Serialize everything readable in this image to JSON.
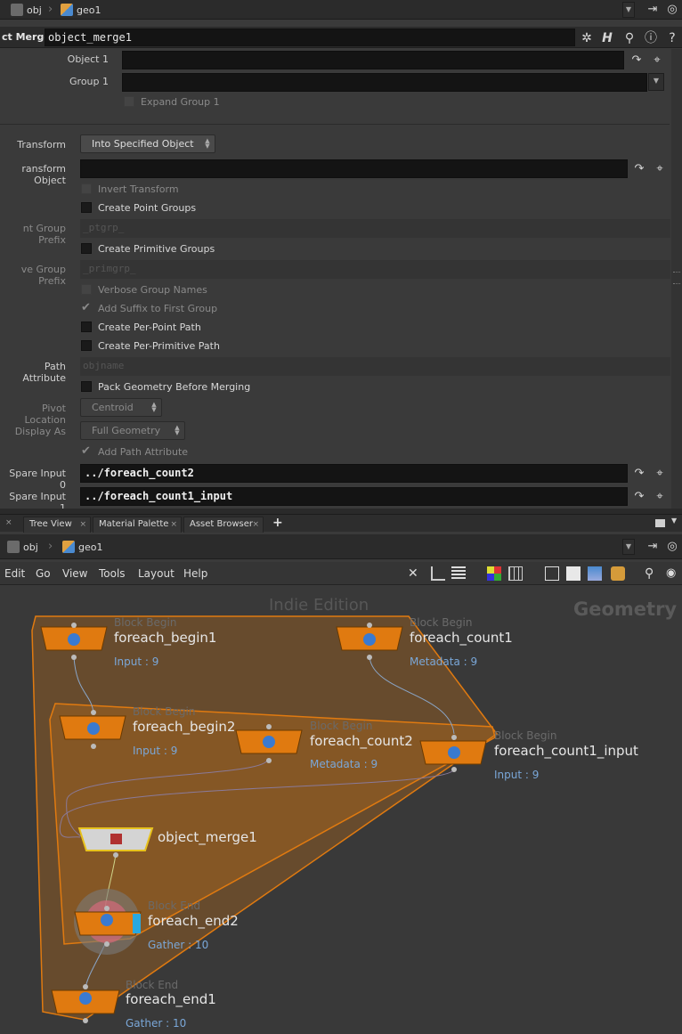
{
  "top_path": {
    "root": "obj",
    "node": "geo1"
  },
  "node_header": {
    "type_label": "ct Merge",
    "name": "object_merge1"
  },
  "params": {
    "object1": {
      "label": "Object 1",
      "value": ""
    },
    "group1": {
      "label": "Group 1",
      "value": ""
    },
    "expand_group1": {
      "label": "Expand Group 1",
      "checked": false
    },
    "transform": {
      "label": "Transform",
      "value": "Into Specified Object"
    },
    "transform_object": {
      "label": "ransform Object",
      "value": ""
    },
    "invert_transform": {
      "label": "Invert Transform",
      "checked": false
    },
    "create_point_groups": {
      "label": "Create Point Groups",
      "checked": false
    },
    "point_group_prefix": {
      "label": "nt Group Prefix",
      "value": "_ptgrp_"
    },
    "create_primitive_groups": {
      "label": "Create Primitive Groups",
      "checked": false
    },
    "primitive_group_prefix": {
      "label": "ve Group Prefix",
      "value": "_primgrp_"
    },
    "verbose_group_names": {
      "label": "Verbose Group Names",
      "checked": false
    },
    "add_suffix": {
      "label": "Add Suffix to First Group",
      "checked": true
    },
    "per_point_path": {
      "label": "Create Per-Point Path",
      "checked": false
    },
    "per_prim_path": {
      "label": "Create Per-Primitive Path",
      "checked": false
    },
    "path_attribute": {
      "label": "Path Attribute",
      "value": "objname"
    },
    "pack_geometry": {
      "label": "Pack Geometry Before Merging",
      "checked": false
    },
    "pivot_location": {
      "label": "Pivot Location",
      "value": "Centroid"
    },
    "display_as": {
      "label": "Display As",
      "value": "Full Geometry"
    },
    "add_path_attribute": {
      "label": "Add Path Attribute",
      "checked": true
    },
    "spare_input0": {
      "label": "Spare Input 0",
      "value": "../foreach_count2"
    },
    "spare_input1": {
      "label": "Spare Input 1",
      "value": "../foreach_count1_input"
    }
  },
  "tabs": [
    {
      "label": "Tree View"
    },
    {
      "label": "Material Palette"
    },
    {
      "label": "Asset Browser"
    }
  ],
  "tab_add": "+",
  "net_path": {
    "root": "obj",
    "node": "geo1"
  },
  "menu": [
    "Edit",
    "Go",
    "View",
    "Tools",
    "Layout",
    "Help"
  ],
  "network": {
    "watermark": "Indie Edition",
    "context": "Geometry",
    "nodes": [
      {
        "type": "Block Begin",
        "name": "foreach_begin1",
        "info": "Input : 9"
      },
      {
        "type": "Block Begin",
        "name": "foreach_count1",
        "info": "Metadata : 9"
      },
      {
        "type": "Block Begin",
        "name": "foreach_begin2",
        "info": "Input : 9"
      },
      {
        "type": "Block Begin",
        "name": "foreach_count2",
        "info": "Metadata : 9"
      },
      {
        "type": "Block Begin",
        "name": "foreach_count1_input",
        "info": "Input : 9"
      },
      {
        "type": "",
        "name": "object_merge1",
        "info": ""
      },
      {
        "type": "Block End",
        "name": "foreach_end2",
        "info": "Gather : 10"
      },
      {
        "type": "Block End",
        "name": "foreach_end1",
        "info": "Gather : 10"
      }
    ]
  },
  "colors": {
    "accent_orange": "#e07a10",
    "selected_yellow": "#e7c21d",
    "info_blue": "#7aa7d8"
  }
}
